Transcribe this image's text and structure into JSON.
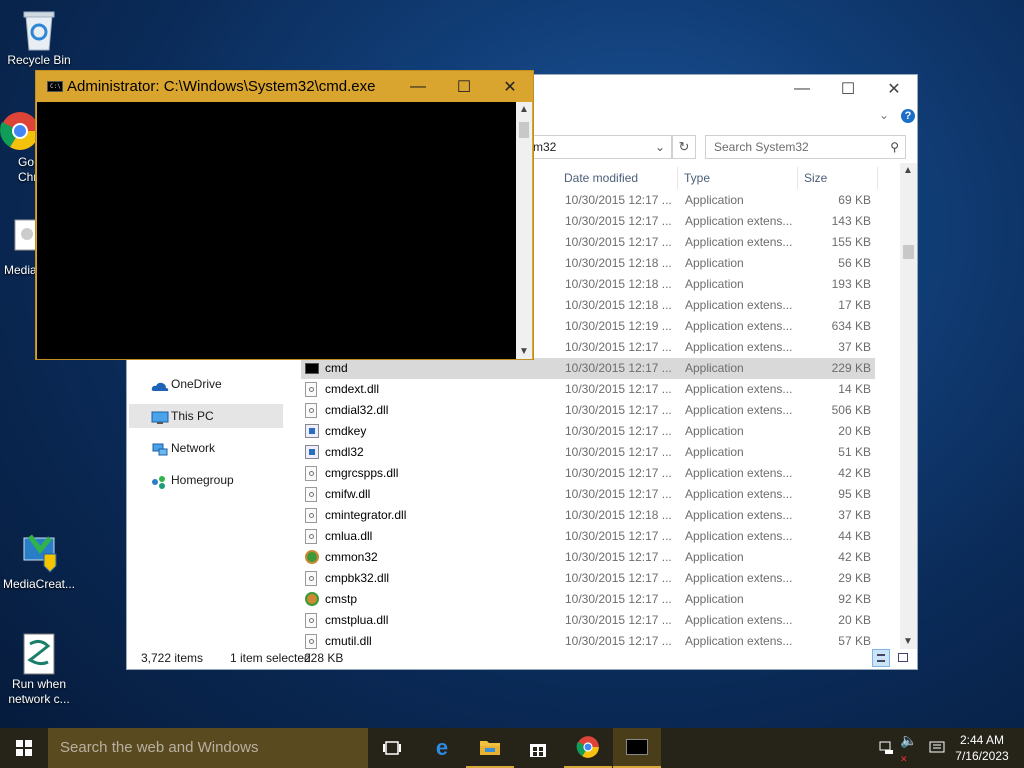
{
  "desktop": {
    "icons": [
      {
        "label": "Recycle Bin"
      },
      {
        "label": "Go\nChr"
      },
      {
        "label": "Media"
      },
      {
        "label": "MediaCreat..."
      },
      {
        "label": "Run when network c..."
      }
    ]
  },
  "cmd_window": {
    "title": "Administrator: C:\\Windows\\System32\\cmd.exe"
  },
  "explorer": {
    "address_tail": "m32",
    "search_placeholder": "Search System32",
    "columns": {
      "date": "Date modified",
      "type": "Type",
      "size": "Size"
    },
    "nav": [
      {
        "label": "OneDrive"
      },
      {
        "label": "This PC"
      },
      {
        "label": "Network"
      },
      {
        "label": "Homegroup"
      }
    ],
    "files": [
      {
        "name": "",
        "date": "10/30/2015 12:17 ...",
        "type": "Application",
        "size": "69 KB"
      },
      {
        "name": "",
        "date": "10/30/2015 12:17 ...",
        "type": "Application extens...",
        "size": "143 KB"
      },
      {
        "name": "",
        "date": "10/30/2015 12:17 ...",
        "type": "Application extens...",
        "size": "155 KB"
      },
      {
        "name": "",
        "date": "10/30/2015 12:18 ...",
        "type": "Application",
        "size": "56 KB"
      },
      {
        "name": "",
        "date": "10/30/2015 12:18 ...",
        "type": "Application",
        "size": "193 KB"
      },
      {
        "name": "",
        "date": "10/30/2015 12:18 ...",
        "type": "Application extens...",
        "size": "17 KB"
      },
      {
        "name": "",
        "date": "10/30/2015 12:19 ...",
        "type": "Application extens...",
        "size": "634 KB"
      },
      {
        "name": "",
        "date": "10/30/2015 12:17 ...",
        "type": "Application extens...",
        "size": "37 KB"
      },
      {
        "name": "cmd",
        "date": "10/30/2015 12:17 ...",
        "type": "Application",
        "size": "229 KB"
      },
      {
        "name": "cmdext.dll",
        "date": "10/30/2015 12:17 ...",
        "type": "Application extens...",
        "size": "14 KB"
      },
      {
        "name": "cmdial32.dll",
        "date": "10/30/2015 12:17 ...",
        "type": "Application extens...",
        "size": "506 KB"
      },
      {
        "name": "cmdkey",
        "date": "10/30/2015 12:17 ...",
        "type": "Application",
        "size": "20 KB"
      },
      {
        "name": "cmdl32",
        "date": "10/30/2015 12:17 ...",
        "type": "Application",
        "size": "51 KB"
      },
      {
        "name": "cmgrcspps.dll",
        "date": "10/30/2015 12:17 ...",
        "type": "Application extens...",
        "size": "42 KB"
      },
      {
        "name": "cmifw.dll",
        "date": "10/30/2015 12:17 ...",
        "type": "Application extens...",
        "size": "95 KB"
      },
      {
        "name": "cmintegrator.dll",
        "date": "10/30/2015 12:18 ...",
        "type": "Application extens...",
        "size": "37 KB"
      },
      {
        "name": "cmlua.dll",
        "date": "10/30/2015 12:17 ...",
        "type": "Application extens...",
        "size": "44 KB"
      },
      {
        "name": "cmmon32",
        "date": "10/30/2015 12:17 ...",
        "type": "Application",
        "size": "42 KB"
      },
      {
        "name": "cmpbk32.dll",
        "date": "10/30/2015 12:17 ...",
        "type": "Application extens...",
        "size": "29 KB"
      },
      {
        "name": "cmstp",
        "date": "10/30/2015 12:17 ...",
        "type": "Application",
        "size": "92 KB"
      },
      {
        "name": "cmstplua.dll",
        "date": "10/30/2015 12:17 ...",
        "type": "Application extens...",
        "size": "20 KB"
      },
      {
        "name": "cmutil.dll",
        "date": "10/30/2015 12:17 ...",
        "type": "Application extens...",
        "size": "57 KB"
      }
    ],
    "status": {
      "count": "3,722 items",
      "selected": "1 item selected",
      "size": "228 KB"
    }
  },
  "taskbar": {
    "search_placeholder": "Search the web and Windows",
    "time": "2:44 AM",
    "date": "7/16/2023"
  },
  "colors": {
    "accent": "#daa52f",
    "taskbar": "#262318",
    "selection": "#d9d9d9"
  }
}
